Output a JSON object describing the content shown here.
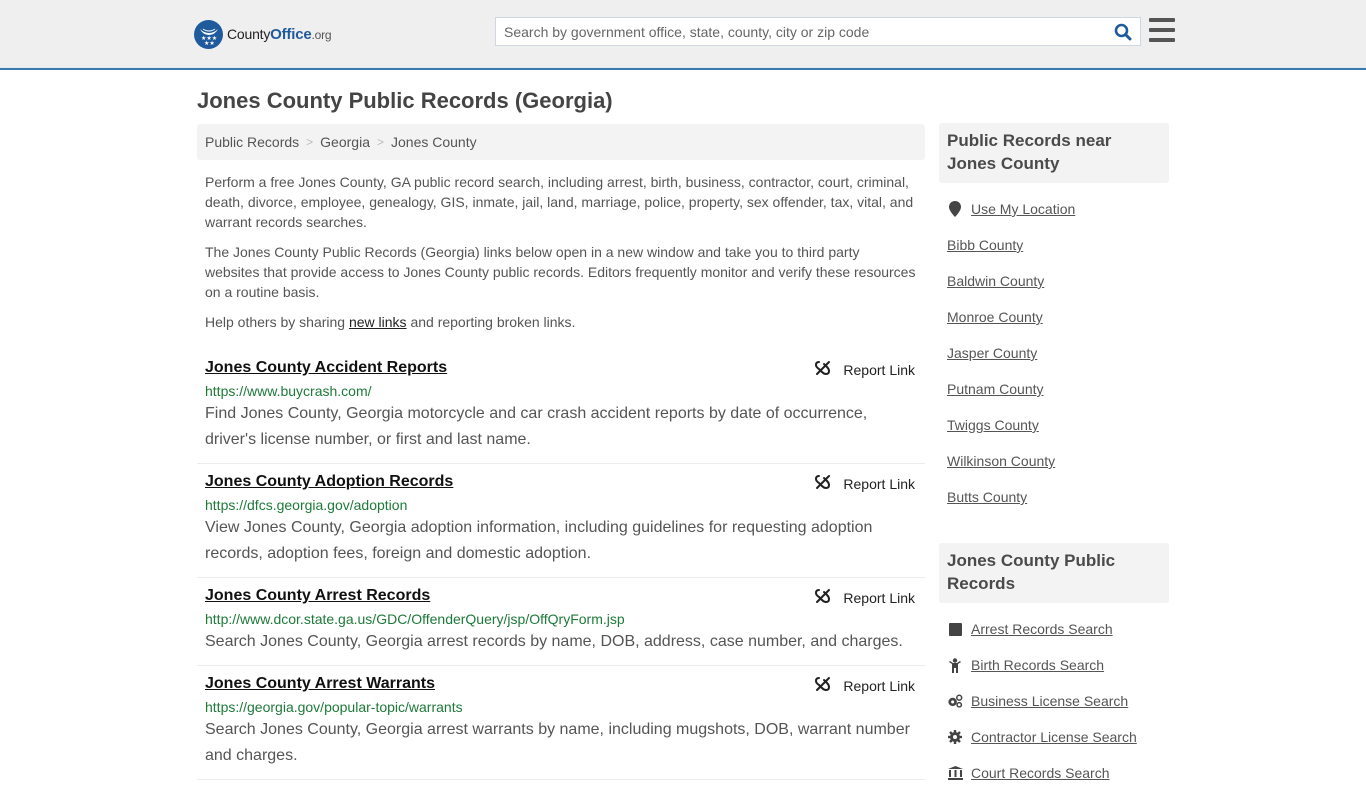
{
  "header": {
    "logo": {
      "county": "County",
      "office": "Office",
      "org": ".org"
    },
    "search_placeholder": "Search by government office, state, county, city or zip code",
    "search_value": "",
    "colors": {
      "accent": "#1f5a9c",
      "header_bg": "#efefef",
      "header_border": "#3a7bab"
    }
  },
  "page": {
    "title": "Jones County Public Records (Georgia)",
    "breadcrumb": [
      "Public Records",
      "Georgia",
      "Jones County"
    ],
    "intro": {
      "p1": "Perform a free Jones County, GA public record search, including arrest, birth, business, contractor, court, criminal, death, divorce, employee, genealogy, GIS, inmate, jail, land, marriage, police, property, sex offender, tax, vital, and warrant records searches.",
      "p2": "The Jones County Public Records (Georgia) links below open in a new window and take you to third party websites that provide access to Jones County public records. Editors frequently monitor and verify these resources on a routine basis.",
      "p3_before": "Help others by sharing ",
      "p3_link": "new links",
      "p3_after": " and reporting broken links."
    },
    "report_link_label": "Report Link",
    "records": [
      {
        "title": "Jones County Accident Reports",
        "url": "https://www.buycrash.com/",
        "description": "Find Jones County, Georgia motorcycle and car crash accident reports by date of occurrence, driver's license number, or first and last name."
      },
      {
        "title": "Jones County Adoption Records",
        "url": "https://dfcs.georgia.gov/adoption",
        "description": "View Jones County, Georgia adoption information, including guidelines for requesting adoption records, adoption fees, foreign and domestic adoption."
      },
      {
        "title": "Jones County Arrest Records",
        "url": "http://www.dcor.state.ga.us/GDC/OffenderQuery/jsp/OffQryForm.jsp",
        "description": "Search Jones County, Georgia arrest records by name, DOB, address, case number, and charges."
      },
      {
        "title": "Jones County Arrest Warrants",
        "url": "https://georgia.gov/popular-topic/warrants",
        "description": "Search Jones County, Georgia arrest warrants by name, including mugshots, DOB, warrant number and charges."
      }
    ]
  },
  "sidebar": {
    "nearby": {
      "heading": "Public Records near Jones County",
      "use_location": {
        "label": "Use My Location",
        "icon": "map-marker-icon"
      },
      "counties": [
        "Bibb County",
        "Baldwin County",
        "Monroe County",
        "Jasper County",
        "Putnam County",
        "Twiggs County",
        "Wilkinson County",
        "Butts County"
      ]
    },
    "county_records": {
      "heading": "Jones County Public Records",
      "items": [
        {
          "label": "Arrest Records Search",
          "icon": "square-icon"
        },
        {
          "label": "Birth Records Search",
          "icon": "child-icon"
        },
        {
          "label": "Business License Search",
          "icon": "gears-icon"
        },
        {
          "label": "Contractor License Search",
          "icon": "gear-icon"
        },
        {
          "label": "Court Records Search",
          "icon": "courthouse-icon"
        }
      ]
    }
  }
}
